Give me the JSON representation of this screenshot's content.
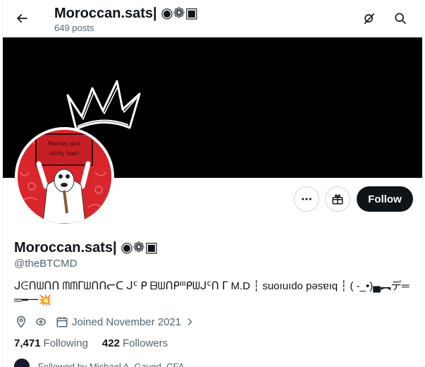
{
  "header": {
    "title": "Moroccan.sats| ◉❁▣",
    "posts_count": "649 posts"
  },
  "avatar": {
    "sign_text_line1": "Memes god",
    "sign_text_line2": "utility bad!"
  },
  "actions": {
    "follow_label": "Follow"
  },
  "profile": {
    "name": "Moroccan.sats| ◉❁▣",
    "handle": "@theBTCMD",
    "bio": "ᒍᕮᑎᗯᑎᑎ ᗰᗰᒥᗯᑎᑎᓕᑕ ᒍᑦ ᑭ ᗷᗯᑎᑭᑊᑊᑊᑭᗯᒍᑦᑎ ᒥ M.D ┆ suoıuıdo pǝsɐıq ┆ ( -_•)▄︻デ══━一💥"
  },
  "meta": {
    "joined": "Joined November 2021"
  },
  "stats": {
    "following_count": "7,471",
    "following_label": "Following",
    "followers_count": "422",
    "followers_label": "Followers"
  },
  "followed_by": {
    "text": "Followed by Michael A. Gayed, CFA"
  },
  "colors": {
    "accent": "#0f1419",
    "muted": "#536471",
    "banner": "#000000",
    "avatar_bg": "#d8262c"
  }
}
